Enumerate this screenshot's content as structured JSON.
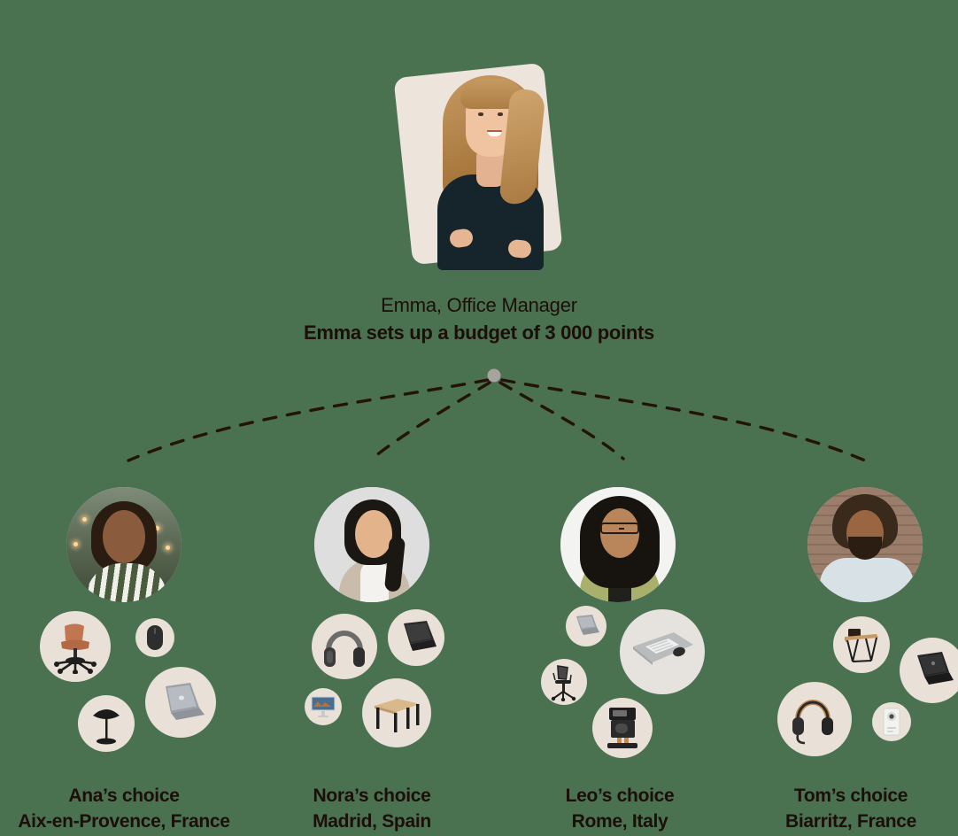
{
  "background_color": "#4A7150",
  "bubble_color": "#E9E0D7",
  "text_color": "#1C0E08",
  "node_color": "#A8A39C",
  "manager": {
    "photo_alt": "emma-portrait",
    "role": "Emma, Office Manager",
    "budget": "Emma sets up a budget of 3 000 points",
    "card_color": "#EDE5DC"
  },
  "connectors": {
    "node_label": "budget-distribution-node",
    "style": "dashed",
    "count": 4
  },
  "people": [
    {
      "id": "ana",
      "avatar_name": "avatar-ana",
      "name": "Ana’s choice",
      "city": "Aix-en-Provence, France",
      "products": [
        {
          "icon": "office-chair-icon",
          "label": "Office chair"
        },
        {
          "icon": "computer-mouse-icon",
          "label": "Wireless mouse"
        },
        {
          "icon": "table-lamp-icon",
          "label": "Table lamp"
        },
        {
          "icon": "laptop-icon",
          "label": "Laptop"
        }
      ]
    },
    {
      "id": "nora",
      "avatar_name": "avatar-nora",
      "name": "Nora’s choice",
      "city": "Madrid, Spain",
      "products": [
        {
          "icon": "headphones-icon",
          "label": "Over-ear headphones"
        },
        {
          "icon": "laptop-icon",
          "label": "Laptop"
        },
        {
          "icon": "monitor-icon",
          "label": "Monitor"
        },
        {
          "icon": "desk-icon",
          "label": "Wooden desk"
        }
      ]
    },
    {
      "id": "leo",
      "avatar_name": "avatar-leo",
      "name": "Leo’s choice",
      "city": "Rome, Italy",
      "products": [
        {
          "icon": "laptop-icon",
          "label": "Laptop"
        },
        {
          "icon": "keyboard-mousepad-icon",
          "label": "Keyboard and desk pad"
        },
        {
          "icon": "mesh-office-chair-icon",
          "label": "Mesh office chair"
        },
        {
          "icon": "coffee-machine-icon",
          "label": "Coffee machine"
        }
      ]
    },
    {
      "id": "tom",
      "avatar_name": "avatar-tom",
      "name": "Tom’s choice",
      "city": "Biarritz, France",
      "products": [
        {
          "icon": "desk-icon",
          "label": "Writing desk"
        },
        {
          "icon": "laptop-icon",
          "label": "Laptop"
        },
        {
          "icon": "headset-icon",
          "label": "Headset with microphone"
        },
        {
          "icon": "webcam-icon",
          "label": "Webcam"
        }
      ]
    }
  ]
}
